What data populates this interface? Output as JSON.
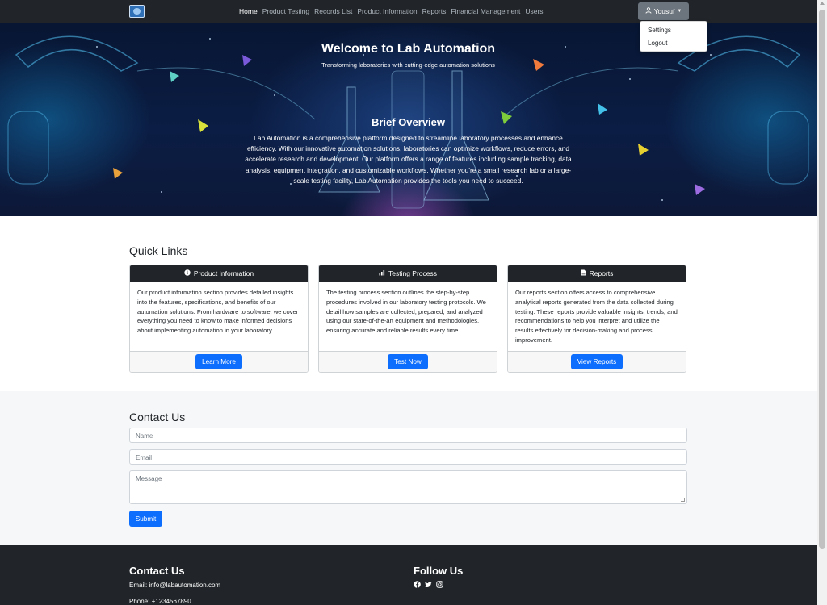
{
  "nav": {
    "items": [
      "Home",
      "Product Testing",
      "Records List",
      "Product Information",
      "Reports",
      "Financial Management",
      "Users"
    ],
    "active": "Home",
    "user": "Yousuf",
    "dropdown": [
      "Settings",
      "Logout"
    ]
  },
  "hero": {
    "title": "Welcome to Lab Automation",
    "subtitle": "Transforming laboratories with cutting-edge automation solutions",
    "overview_title": "Brief Overview",
    "overview_text": "Lab Automation is a comprehensive platform designed to streamline laboratory processes and enhance efficiency. With our innovative automation solutions, laboratories can optimize workflows, reduce errors, and accelerate research and development. Our platform offers a range of features including sample tracking, data analysis, equipment integration, and customizable workflows. Whether you're a small research lab or a large-scale testing facility, Lab Automation provides the tools you need to succeed."
  },
  "quick_links": {
    "heading": "Quick Links",
    "cards": [
      {
        "title": "Product Information",
        "icon": "info-icon",
        "body": "Our product information section provides detailed insights into the features, specifications, and benefits of our automation solutions. From hardware to software, we cover everything you need to know to make informed decisions about implementing automation in your laboratory.",
        "button": "Learn More"
      },
      {
        "title": "Testing Process",
        "icon": "bar-chart-icon",
        "body": "The testing process section outlines the step-by-step procedures involved in our laboratory testing protocols. We detail how samples are collected, prepared, and analyzed using our state-of-the-art equipment and methodologies, ensuring accurate and reliable results every time.",
        "button": "Test Now"
      },
      {
        "title": "Reports",
        "icon": "file-icon",
        "body": "Our reports section offers access to comprehensive analytical reports generated from the data collected during testing. These reports provide valuable insights, trends, and recommendations to help you interpret and utilize the results effectively for decision-making and process improvement.",
        "button": "View Reports"
      }
    ]
  },
  "contact": {
    "heading": "Contact Us",
    "name_placeholder": "Name",
    "email_placeholder": "Email",
    "message_placeholder": "Message",
    "submit": "Submit"
  },
  "footer": {
    "contact_heading": "Contact Us",
    "email": "Email: info@labautomation.com",
    "phone": "Phone: +1234567890",
    "follow_heading": "Follow Us",
    "social_icons": [
      "facebook-icon",
      "twitter-icon",
      "instagram-icon"
    ]
  },
  "colors": {
    "navbar": "#212529",
    "primary": "#0d6efd",
    "user_button": "#6c757d",
    "contact_bg": "#f6f7f8"
  }
}
